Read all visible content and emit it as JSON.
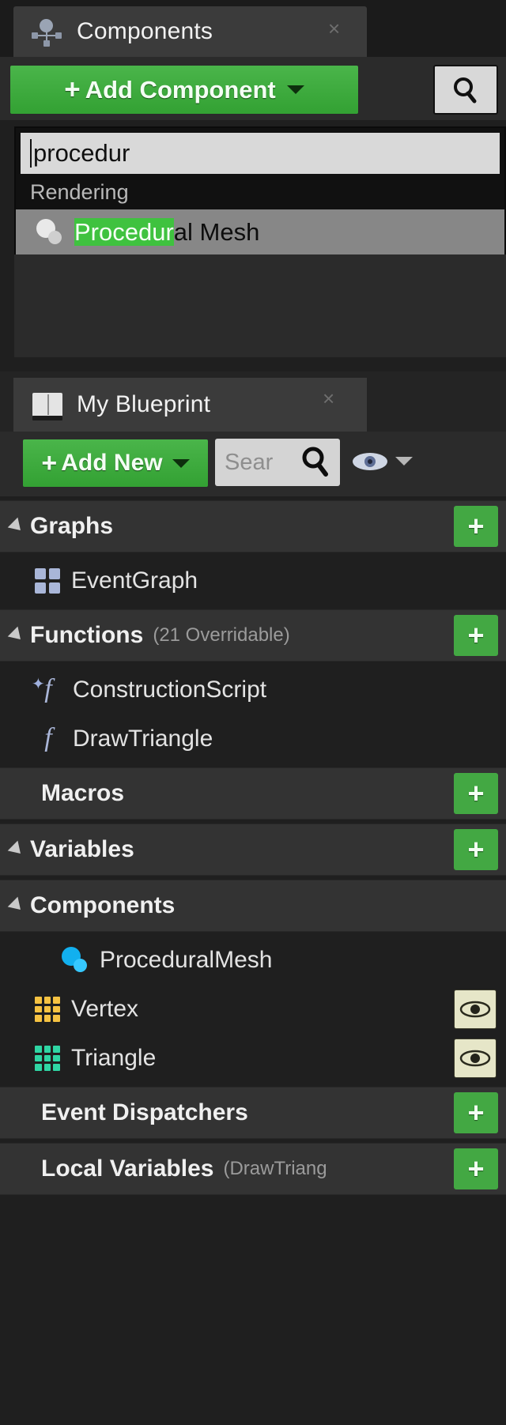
{
  "colors": {
    "green_button": "#3fa93f",
    "highlight_green": "#3fc23f",
    "panel_bg": "#1f1f1f",
    "section_bg": "#333333",
    "vertex_icon": "#f5c242",
    "triangle_icon": "#2fd6a4",
    "sphere_icon": "#12b0ef"
  },
  "components_panel": {
    "tab": {
      "label": "Components",
      "icon": "components-icon",
      "close_label": "×"
    },
    "toolbar": {
      "add_component_label": "Add Component",
      "add_component_plus": "+",
      "search_icon": "search-icon"
    },
    "dropdown": {
      "search_value": "procedur",
      "category": "Rendering",
      "items": [
        {
          "icon": "procedural-mesh-sphere-icon",
          "match_text": "Procedur",
          "rest_text": "al Mesh"
        }
      ]
    }
  },
  "myblueprint_panel": {
    "tab": {
      "label": "My Blueprint",
      "icon": "blueprint-book-icon",
      "close_label": "×"
    },
    "toolbar": {
      "add_new_label": "Add New",
      "add_new_plus": "+",
      "search_placeholder": "Sear",
      "search_icon": "search-icon",
      "visibility_icon": "eye-icon",
      "visibility_caret": "chevron-down-icon"
    },
    "sections": [
      {
        "id": "graphs",
        "title": "Graphs",
        "subtitle": "",
        "expandable": true,
        "has_add": true,
        "add_label": "+",
        "indented": false,
        "items": [
          {
            "label": "EventGraph",
            "icon": "event-graph-icon",
            "eye": false
          }
        ]
      },
      {
        "id": "functions",
        "title": "Functions",
        "subtitle": "(21 Overridable)",
        "expandable": true,
        "has_add": true,
        "add_label": "+",
        "indented": false,
        "items": [
          {
            "label": "ConstructionScript",
            "icon": "construction-script-icon",
            "eye": false
          },
          {
            "label": "DrawTriangle",
            "icon": "function-icon",
            "eye": false
          }
        ]
      },
      {
        "id": "macros",
        "title": "Macros",
        "subtitle": "",
        "expandable": false,
        "has_add": true,
        "add_label": "+",
        "indented": true,
        "items": []
      },
      {
        "id": "variables",
        "title": "Variables",
        "subtitle": "",
        "expandable": true,
        "has_add": true,
        "add_label": "+",
        "indented": false,
        "items": []
      },
      {
        "id": "components",
        "title": "Components",
        "subtitle": "",
        "expandable": true,
        "has_add": false,
        "add_label": "",
        "indented": false,
        "items": [
          {
            "label": "ProceduralMesh",
            "icon": "procedural-mesh-sphere-icon",
            "eye": false,
            "deep": true
          },
          {
            "label": "Vertex",
            "icon": "vertex-array-icon",
            "eye": true,
            "deep": false
          },
          {
            "label": "Triangle",
            "icon": "triangle-array-icon",
            "eye": true,
            "deep": false
          }
        ]
      },
      {
        "id": "event-dispatchers",
        "title": "Event Dispatchers",
        "subtitle": "",
        "expandable": false,
        "has_add": true,
        "add_label": "+",
        "indented": true,
        "items": []
      },
      {
        "id": "local-variables",
        "title": "Local Variables",
        "subtitle": "(DrawTriang",
        "expandable": false,
        "has_add": true,
        "add_label": "+",
        "indented": true,
        "items": []
      }
    ]
  }
}
